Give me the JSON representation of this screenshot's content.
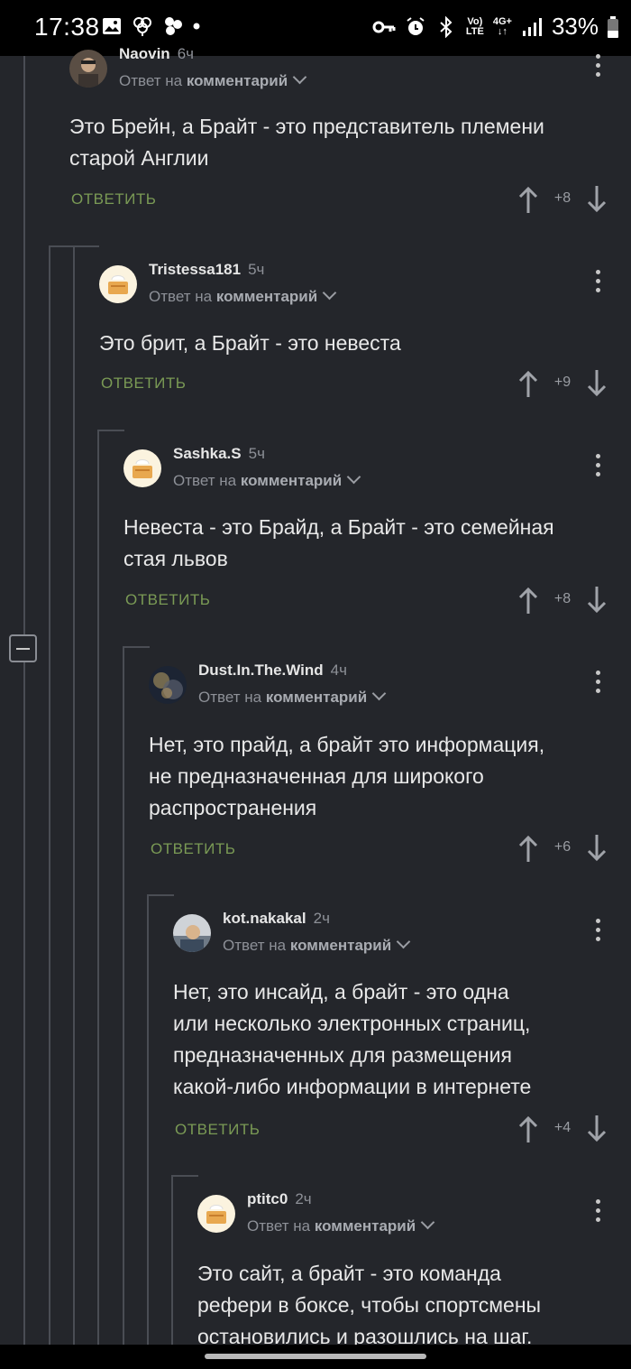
{
  "status": {
    "time": "17:38",
    "battery": "33%",
    "network_top": "Vo)",
    "network_bottom": "LTE",
    "gen_top": "4G+"
  },
  "comments": [
    {
      "author": "Naovin",
      "age": "6ч",
      "reply_prefix": "Ответ на",
      "reply_target": "комментарий",
      "lines": [
        "Это Брейн, а Брайт - это представитель племени",
        "старой Англии"
      ],
      "reply_label": "ОТВЕТИТЬ",
      "score": "+8"
    },
    {
      "author": "Tristessa181",
      "age": "5ч",
      "reply_prefix": "Ответ на",
      "reply_target": "комментарий",
      "lines": [
        "Это брит, а Брайт - это невеста"
      ],
      "reply_label": "ОТВЕТИТЬ",
      "score": "+9"
    },
    {
      "author": "Sashka.S",
      "age": "5ч",
      "reply_prefix": "Ответ на",
      "reply_target": "комментарий",
      "lines": [
        "Невеста - это Брайд, а Брайт - это семейная",
        "стая львов"
      ],
      "reply_label": "ОТВЕТИТЬ",
      "score": "+8"
    },
    {
      "author": "Dust.In.The.Wind",
      "age": "4ч",
      "reply_prefix": "Ответ на",
      "reply_target": "комментарий",
      "lines": [
        "Нет, это прайд, а брайт это информация,",
        "не предназначенная для широкого",
        "распространения"
      ],
      "reply_label": "ОТВЕТИТЬ",
      "score": "+6"
    },
    {
      "author": "kot.nakakal",
      "age": "2ч",
      "reply_prefix": "Ответ на",
      "reply_target": "комментарий",
      "lines": [
        "Нет, это инсайд, а брайт - это одна",
        "или несколько электронных страниц,",
        "предназначенных для размещения",
        "какой-либо информации в интернете"
      ],
      "reply_label": "ОТВЕТИТЬ",
      "score": "+4"
    },
    {
      "author": "ptitc0",
      "age": "2ч",
      "reply_prefix": "Ответ на",
      "reply_target": "комментарий",
      "lines": [
        "Это сайт, а брайт - это команда",
        "рефери в боксе, чтобы спортсмены",
        "остановились и разошлись на шаг."
      ],
      "reply_label": "",
      "score": ""
    }
  ]
}
